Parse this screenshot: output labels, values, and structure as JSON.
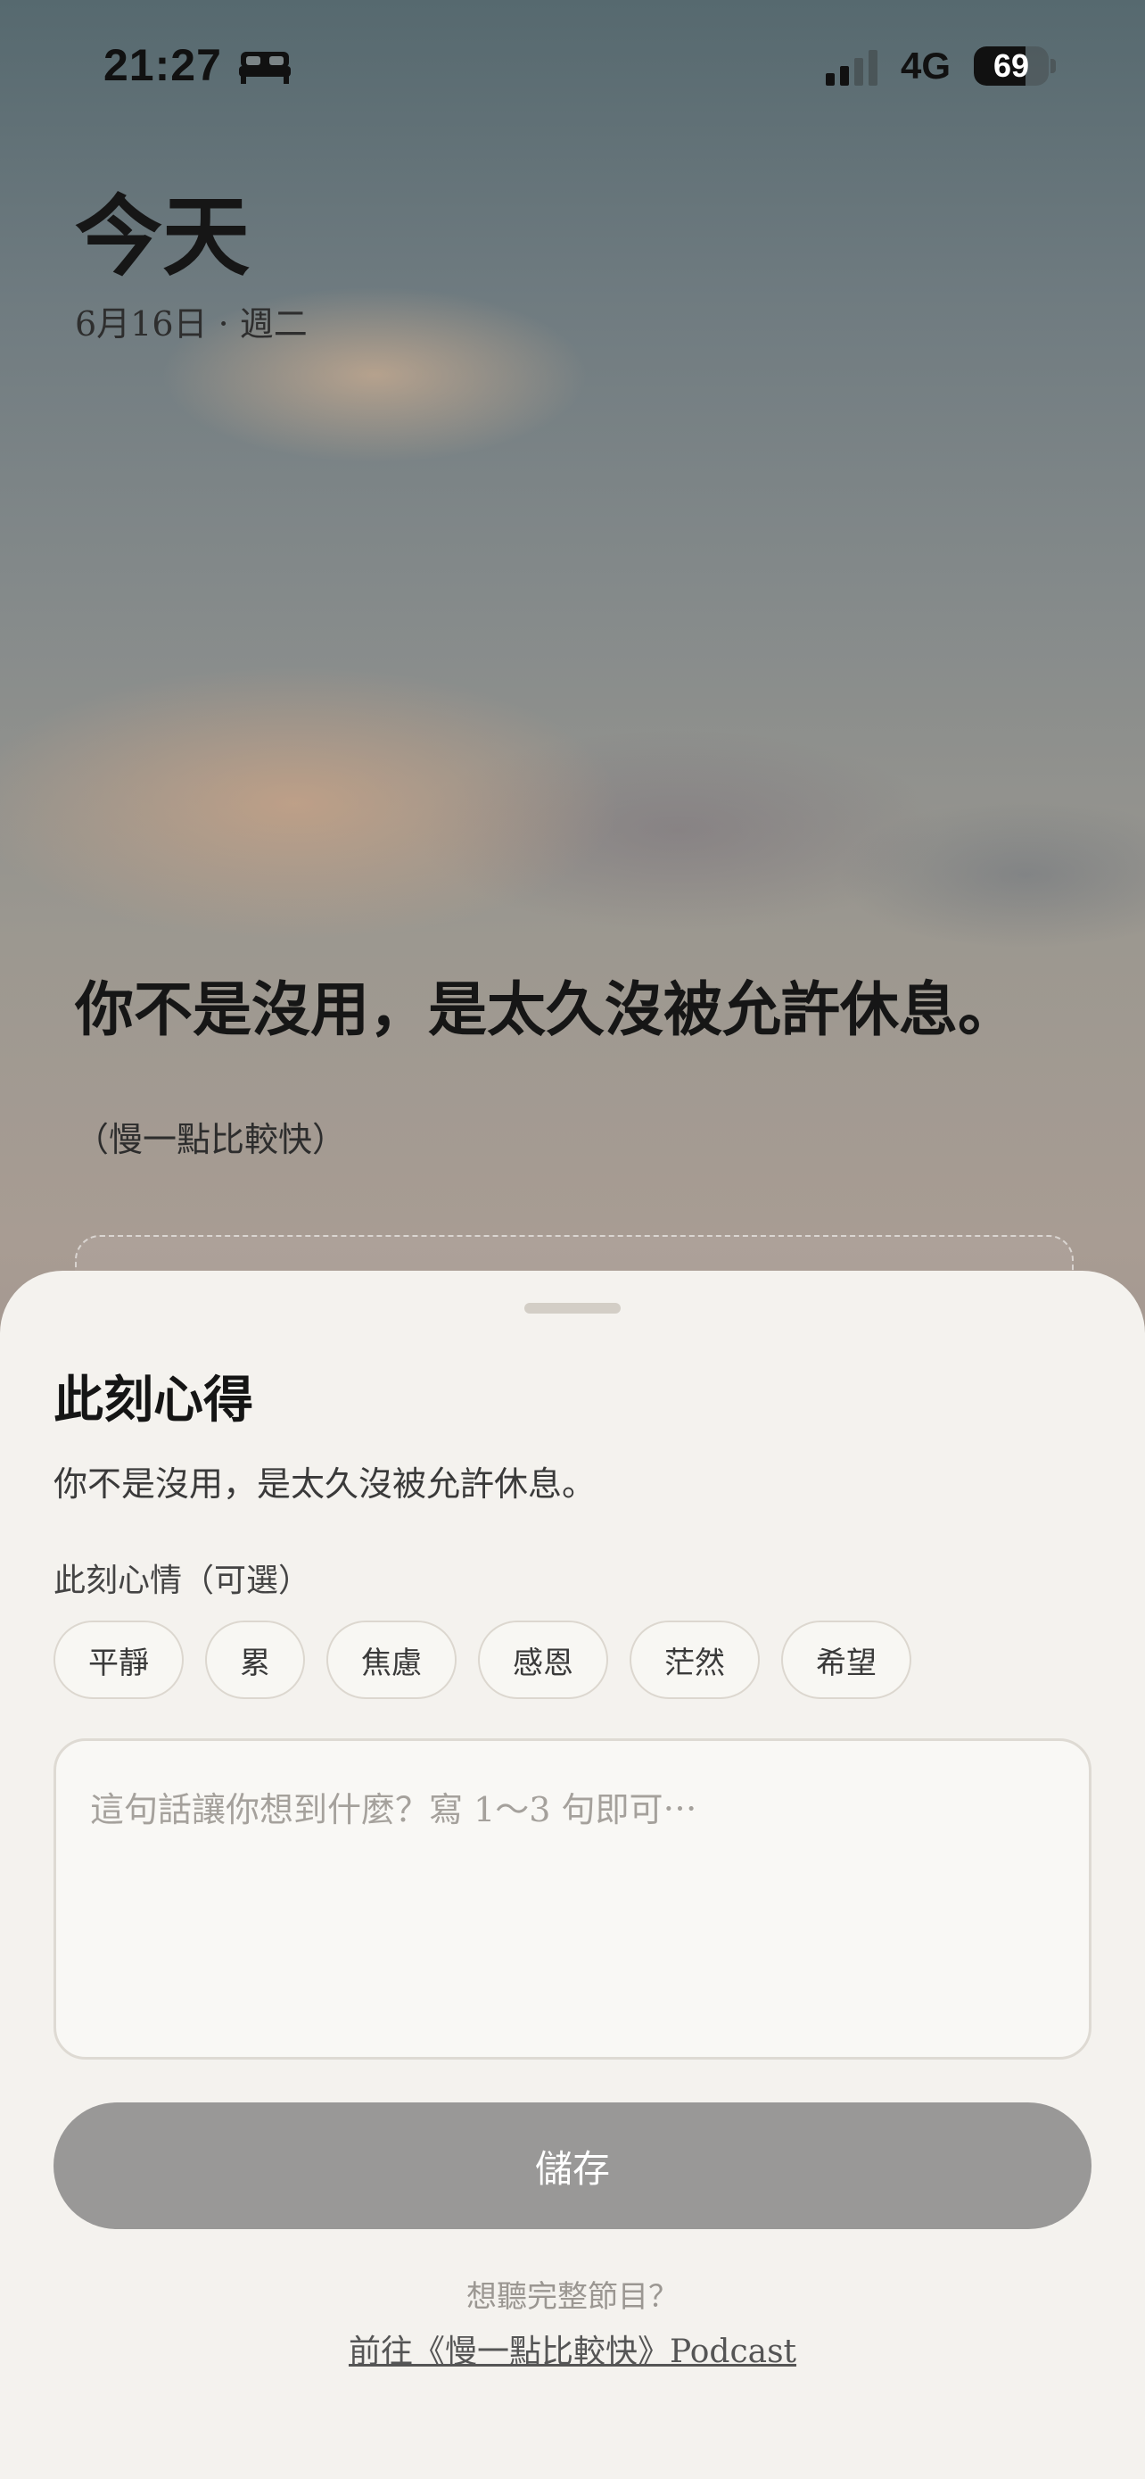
{
  "status_bar": {
    "time": "21:27",
    "focus_icon": "bed-icon",
    "network": "4G",
    "battery": "69",
    "battery_level": 0.69
  },
  "header": {
    "title": "今天",
    "date": "6月16日 · 週二"
  },
  "hero": {
    "quote": "你不是沒用，是太久沒被允許休息。",
    "source": "（慢一點比較快）"
  },
  "sheet": {
    "title": "此刻心得",
    "quote": "你不是沒用，是太久沒被允許休息。",
    "mood_label": "此刻心情（可選）",
    "moods": [
      "平靜",
      "累",
      "焦慮",
      "感恩",
      "茫然",
      "希望"
    ],
    "note_placeholder": "這句話讓你想到什麼？寫 1～3 句即可⋯",
    "save_label": "儲存",
    "podcast_prompt": "想聽完整節目？",
    "podcast_link": "前往《慢一點比較快》Podcast"
  },
  "colors": {
    "sheet_background": "#f4f2ee",
    "save_button": "#999897",
    "chip_border": "#dcd7cf"
  }
}
